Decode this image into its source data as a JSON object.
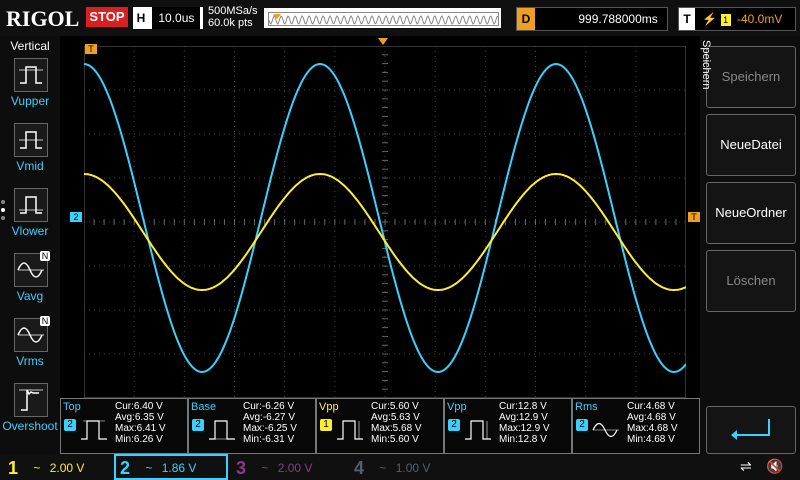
{
  "topbar": {
    "logo": "RIGOL",
    "run_state": "STOP",
    "horizontal_key": "H",
    "timebase": "10.0us",
    "sample_rate": "500MSa/s",
    "memory_depth": "60.0k pts",
    "delay_key": "D",
    "delay_value": "999.788000ms",
    "trigger_key": "T",
    "trigger_source_icon": "ch1",
    "trigger_level": "-40.0mV"
  },
  "left_menu": {
    "title": "Vertical",
    "items": [
      {
        "label": "Vupper",
        "icon": "vupper-icon"
      },
      {
        "label": "Vmid",
        "icon": "vmid-icon"
      },
      {
        "label": "Vlower",
        "icon": "vlower-icon"
      },
      {
        "label": "Vavg",
        "icon": "vavg-icon",
        "badge": "N"
      },
      {
        "label": "Vrms",
        "icon": "vrms-icon",
        "badge": "N"
      },
      {
        "label": "Overshoot",
        "icon": "overshoot-icon"
      }
    ]
  },
  "right_menu": {
    "title": "Speichern",
    "buttons": [
      {
        "label": "Speichern",
        "enabled": false
      },
      {
        "label": "NeueDatei",
        "enabled": true
      },
      {
        "label": "NeueOrdner",
        "enabled": true
      },
      {
        "label": "Löschen",
        "enabled": false
      }
    ]
  },
  "measurements": [
    {
      "name": "Top",
      "channel": "2",
      "cur": "Cur:6.40 V",
      "avg": "Avg:6.35 V",
      "max": "Max:6.41 V",
      "min": "Min:6.26 V"
    },
    {
      "name": "Base",
      "channel": "2",
      "cur": "Cur:-6.26 V",
      "avg": "Avg:-6.27 V",
      "max": "Max:-6.25 V",
      "min": "Min:-6.31 V"
    },
    {
      "name": "Vpp",
      "channel": "1",
      "cur": "Cur:5.60 V",
      "avg": "Avg:5.63 V",
      "max": "Max:5.68 V",
      "min": "Min:5.60 V"
    },
    {
      "name": "Vpp",
      "channel": "2",
      "cur": "Cur:12.8 V",
      "avg": "Avg:12.9 V",
      "max": "Max:12.9 V",
      "min": "Min:12.8 V"
    },
    {
      "name": "Rms",
      "channel": "2",
      "cur": "Cur:4.68 V",
      "avg": "Avg:4.68 V",
      "max": "Max:4.68 V",
      "min": "Min:4.68 V"
    }
  ],
  "channels": [
    {
      "num": "1",
      "coupling": "~",
      "scale": "2.00 V",
      "color": "#ffee30"
    },
    {
      "num": "2",
      "coupling": "~",
      "scale": "1.86 V",
      "color": "#3ad0ff"
    },
    {
      "num": "3",
      "coupling": "~",
      "scale": "2.00 V",
      "color": "#8a3a8a"
    },
    {
      "num": "4",
      "coupling": "~",
      "scale": "1.00 V",
      "color": "#506070"
    }
  ],
  "markers": {
    "ch1_marker": "1",
    "ch2_marker": "2",
    "trigger_marker": "T"
  },
  "colors": {
    "ch1": "#ffee30",
    "ch2": "#3ad0ff",
    "trigger": "#f0a020",
    "stop": "#d82020"
  }
}
